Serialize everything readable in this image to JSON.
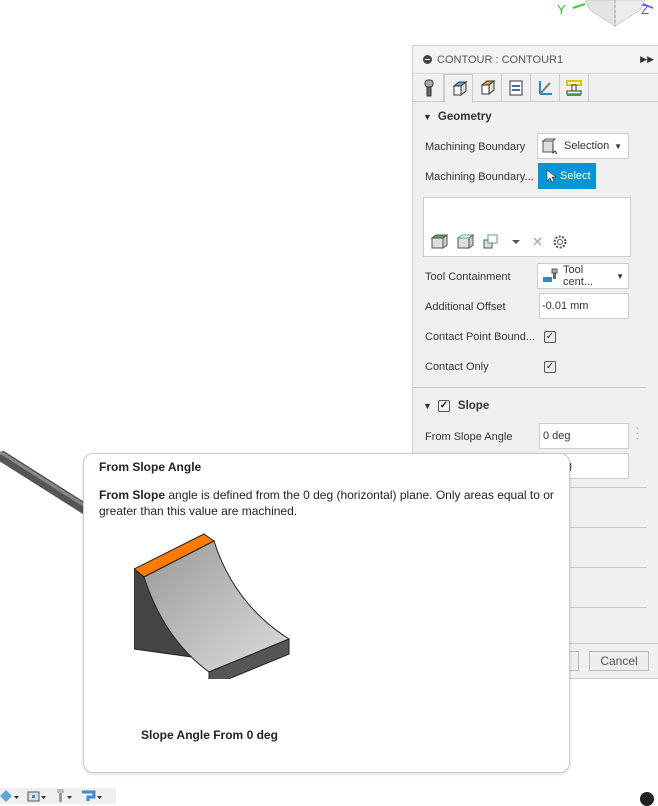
{
  "viewcube": {
    "y_label": "Y",
    "z_label": "Z"
  },
  "panel": {
    "title": "CONTOUR : CONTOUR1",
    "tabs": [
      "tool-icon",
      "geometry-icon",
      "heights-icon",
      "passes-icon",
      "linking-icon",
      "post-icon"
    ],
    "geometry": {
      "header": "Geometry",
      "machining_boundary_label": "Machining Boundary",
      "machining_boundary_value": "Selection",
      "machining_boundary_sel_label": "Machining Boundary...",
      "select_button": "Select",
      "tool_containment_label": "Tool Containment",
      "tool_containment_value": "Tool cent...",
      "additional_offset_label": "Additional Offset",
      "additional_offset_value": "-0.01 mm",
      "contact_point_label": "Contact Point Bound...",
      "contact_point_checked": true,
      "contact_only_label": "Contact Only",
      "contact_only_checked": true
    },
    "slope": {
      "header": "Slope",
      "enabled": true,
      "from_label": "From Slope Angle",
      "from_value": "0 deg",
      "to_value_partial": "g"
    },
    "cancel_button": "Cancel",
    "accent_color": "#0696d7"
  },
  "tooltip": {
    "title": "From Slope Angle",
    "body_bold": "From Slope",
    "body_rest": " angle is defined from the 0 deg (horizontal) plane. Only areas equal to or greater than this value are machined.",
    "caption": "Slope Angle From 0 deg"
  }
}
